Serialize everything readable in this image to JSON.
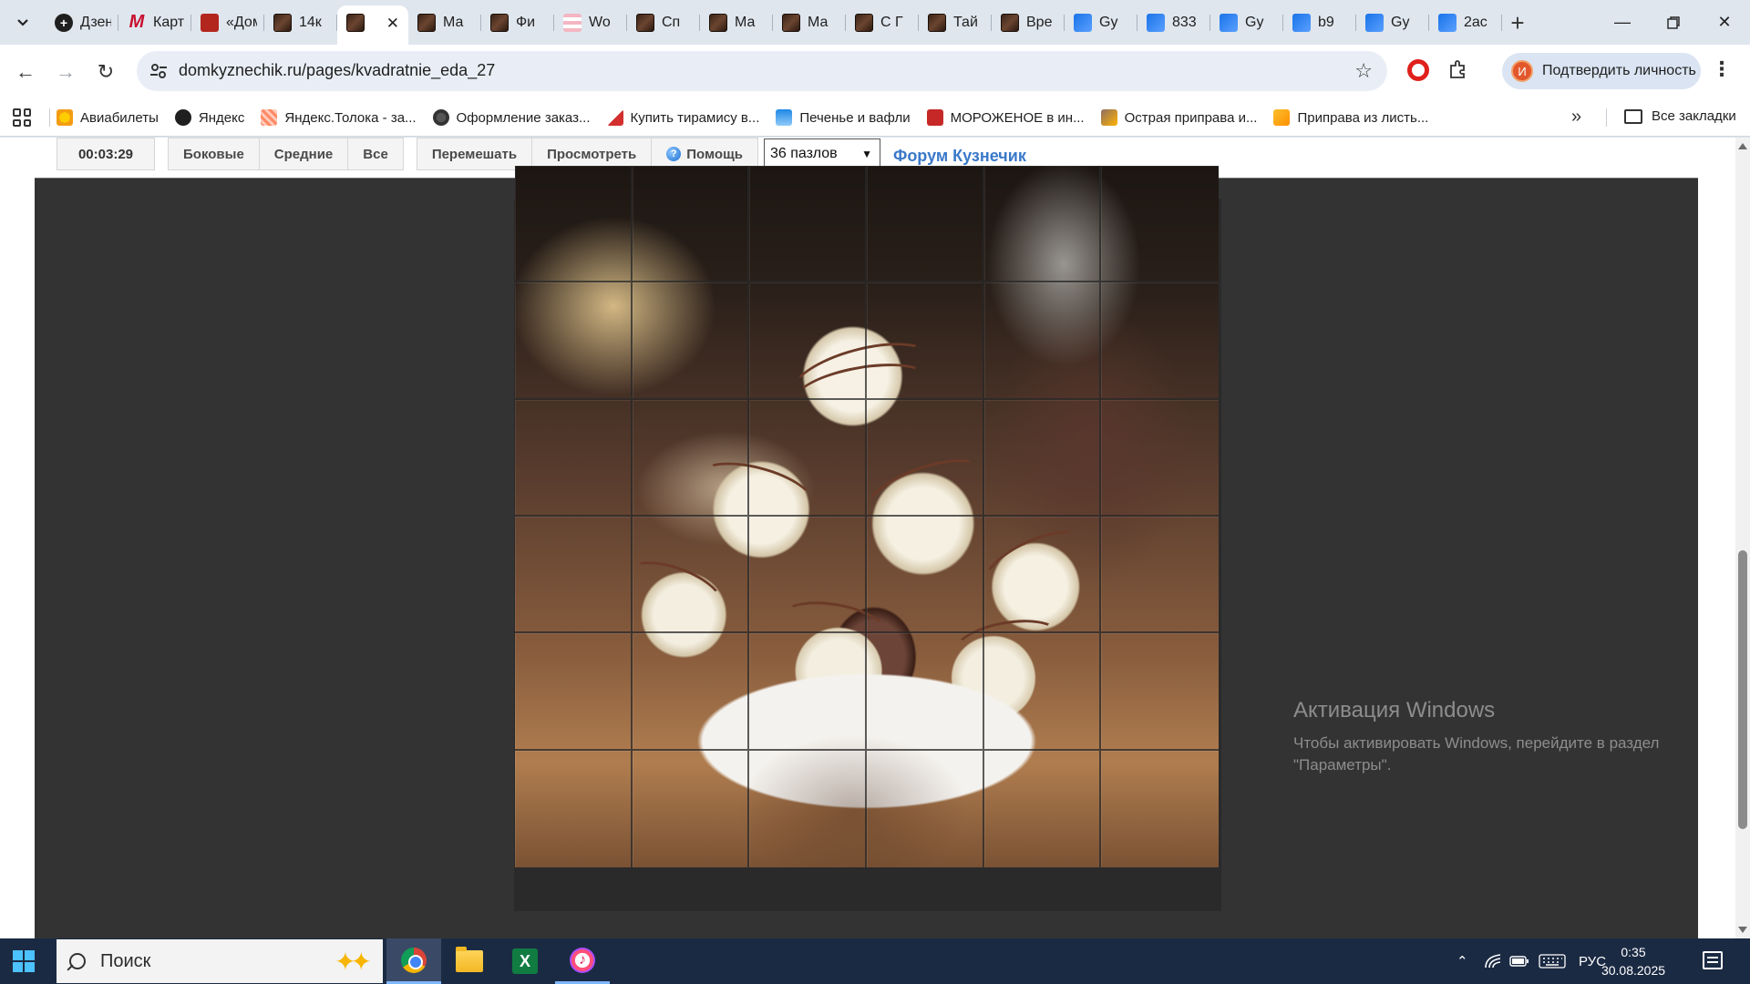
{
  "browser": {
    "tabs": [
      {
        "title": "Дзен",
        "favicon": "yandex-plus-icon"
      },
      {
        "title": "Карты",
        "favicon": "letter-m-icon"
      },
      {
        "title": "«Дом",
        "favicon": "red-site-icon"
      },
      {
        "title": "14к",
        "favicon": "chocolate-icon"
      },
      {
        "title": "",
        "favicon": "chocolate-icon",
        "active": true
      },
      {
        "title": "Ма",
        "favicon": "chocolate-icon"
      },
      {
        "title": "Фи",
        "favicon": "chocolate-icon"
      },
      {
        "title": "Wo",
        "favicon": "cake-icon"
      },
      {
        "title": "Сп",
        "favicon": "chocolate-icon"
      },
      {
        "title": "Ма",
        "favicon": "chocolate-icon"
      },
      {
        "title": "Ма",
        "favicon": "chocolate-icon"
      },
      {
        "title": "С Г",
        "favicon": "chocolate-icon"
      },
      {
        "title": "Тай",
        "favicon": "chocolate-icon"
      },
      {
        "title": "Вре",
        "favicon": "chocolate-icon"
      },
      {
        "title": "Gy",
        "favicon": "blue-app-icon"
      },
      {
        "title": "833",
        "favicon": "blue-app-icon"
      },
      {
        "title": "Gy",
        "favicon": "blue-app-icon"
      },
      {
        "title": "b9",
        "favicon": "blue-app-icon"
      },
      {
        "title": "Gy",
        "favicon": "blue-app-icon"
      },
      {
        "title": "2ac",
        "favicon": "blue-app-icon"
      }
    ],
    "url": "domkyznechik.ru/pages/kvadratnie_eda_27",
    "profile_label": "Подтвердить личность",
    "profile_initial": "И",
    "bookmarks": [
      {
        "label": "Авиабилеты",
        "icon": "plane-icon"
      },
      {
        "label": "Яндекс",
        "icon": "yandex-plus-icon"
      },
      {
        "label": "Яндекс.Толока - за...",
        "icon": "toloka-icon"
      },
      {
        "label": "Оформление заказ...",
        "icon": "globe-icon"
      },
      {
        "label": "Купить тирамису в...",
        "icon": "cake-slice-icon"
      },
      {
        "label": "Печенье и вафли",
        "icon": "cookie-icon"
      },
      {
        "label": "МОРОЖЕНОЕ в ин...",
        "icon": "letter-d-icon"
      },
      {
        "label": "Острая приправа и...",
        "icon": "spice-icon"
      },
      {
        "label": "Приправа из листь...",
        "icon": "herb-icon"
      }
    ],
    "all_bookmarks": "Все закладки"
  },
  "puzzle": {
    "timer": "00:03:29",
    "buttons": {
      "side": "Боковые",
      "middle": "Средние",
      "all": "Все",
      "shuffle": "Перемешать",
      "preview": "Просмотреть",
      "help": "Помощь"
    },
    "pieces_select": "36 пазлов",
    "forum_link": "Форум Кузнечик",
    "grid_cols": 6,
    "grid_rows": 6
  },
  "watermark": {
    "title": "Активация Windows",
    "text": "Чтобы активировать Windows, перейдите в раздел \"Параметры\"."
  },
  "taskbar": {
    "search_placeholder": "Поиск",
    "language": "РУС",
    "time": "0:35",
    "date": "30.08.2025"
  },
  "colors": {
    "accent_link": "#3a79c9",
    "stage_bg": "#333333",
    "taskbar_bg": "#1b2a43"
  }
}
